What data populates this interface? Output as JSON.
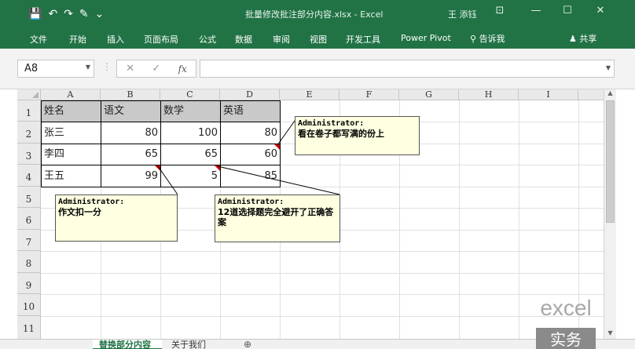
{
  "window": {
    "title": "批量修改批注部分内容.xlsx  -  Excel",
    "user": "王 添钰",
    "qat": [
      "💾",
      "↶",
      "↷",
      "✎",
      "⌄"
    ],
    "controls": [
      "⊡",
      "—",
      "☐",
      "✕"
    ]
  },
  "ribbon": {
    "tabs": [
      "文件",
      "开始",
      "插入",
      "页面布局",
      "公式",
      "数据",
      "审阅",
      "视图",
      "开发工具",
      "Power Pivot"
    ],
    "tell_me": "告诉我",
    "share": "共享"
  },
  "formula_bar": {
    "name_box": "A8",
    "cancel": "✕",
    "enter": "✓",
    "fx": "fx",
    "content": ""
  },
  "grid": {
    "columns": [
      "A",
      "B",
      "C",
      "D",
      "E",
      "F",
      "G",
      "H",
      "I"
    ],
    "rows": [
      "1",
      "2",
      "3",
      "4",
      "5",
      "6",
      "7",
      "8",
      "9",
      "10",
      "11"
    ],
    "table": {
      "headers": [
        "姓名",
        "语文",
        "数学",
        "英语"
      ],
      "rows": [
        [
          "张三",
          "80",
          "100",
          "80"
        ],
        [
          "李四",
          "65",
          "65",
          "60"
        ],
        [
          "王五",
          "99",
          "5",
          "85"
        ]
      ]
    }
  },
  "comments": [
    {
      "author": "Administrator:",
      "text": "看在卷子都写满的份上"
    },
    {
      "author": "Administrator:",
      "text": "作文扣一分"
    },
    {
      "author": "Administrator:",
      "text": "12道选择题完全避开了正确答案"
    }
  ],
  "sheets": {
    "tabs": [
      "替换部分内容",
      "关于我们"
    ],
    "active": 0,
    "add": "⊕"
  },
  "watermark": {
    "line1": "excel",
    "line2": "实务"
  },
  "colors": {
    "accent": "#217346",
    "comment_bg": "#ffffe1",
    "indicator": "#d00000"
  }
}
